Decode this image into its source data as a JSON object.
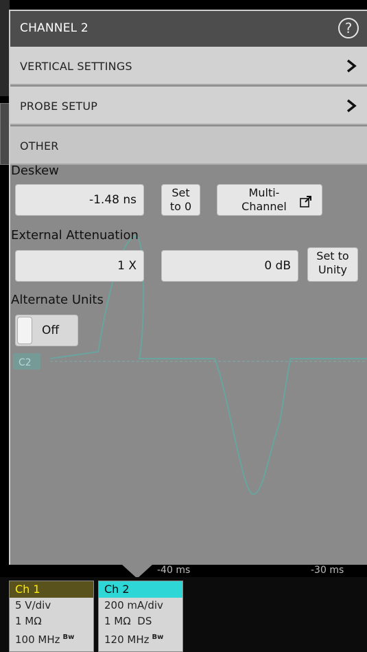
{
  "panel": {
    "title": "CHANNEL 2",
    "help_icon": "help-icon"
  },
  "sections": {
    "vertical": "VERTICAL SETTINGS",
    "probe": "PROBE SETUP",
    "other": "OTHER"
  },
  "deskew": {
    "label": "Deskew",
    "value": "-1.48 ns",
    "set_zero_line1": "Set",
    "set_zero_line2": "to 0",
    "multi_line1": "Multi-",
    "multi_line2": "Channel"
  },
  "external_attenuation": {
    "label": "External Attenuation",
    "factor": "1 X",
    "db": "0 dB",
    "unity_line1": "Set to",
    "unity_line2": "Unity"
  },
  "alternate_units": {
    "label": "Alternate Units",
    "state": "Off"
  },
  "timebase": {
    "left": "-40 ms",
    "right": "-30 ms"
  },
  "channels": {
    "ch1": {
      "name": "Ch 1",
      "scale": "5 V/div",
      "impedance": "1 MΩ",
      "bandwidth": "100 MHz",
      "bw_flag": "Bw",
      "color": "#ffef00"
    },
    "ch2": {
      "name": "Ch 2",
      "scale": "200 mA/div",
      "impedance": "1 MΩ",
      "ds": "DS",
      "bandwidth": "120 MHz",
      "bw_flag": "Bw",
      "color": "#2fd6d6"
    }
  },
  "waveform": {
    "marker_label": "C2",
    "color": "#4fb9b0"
  }
}
